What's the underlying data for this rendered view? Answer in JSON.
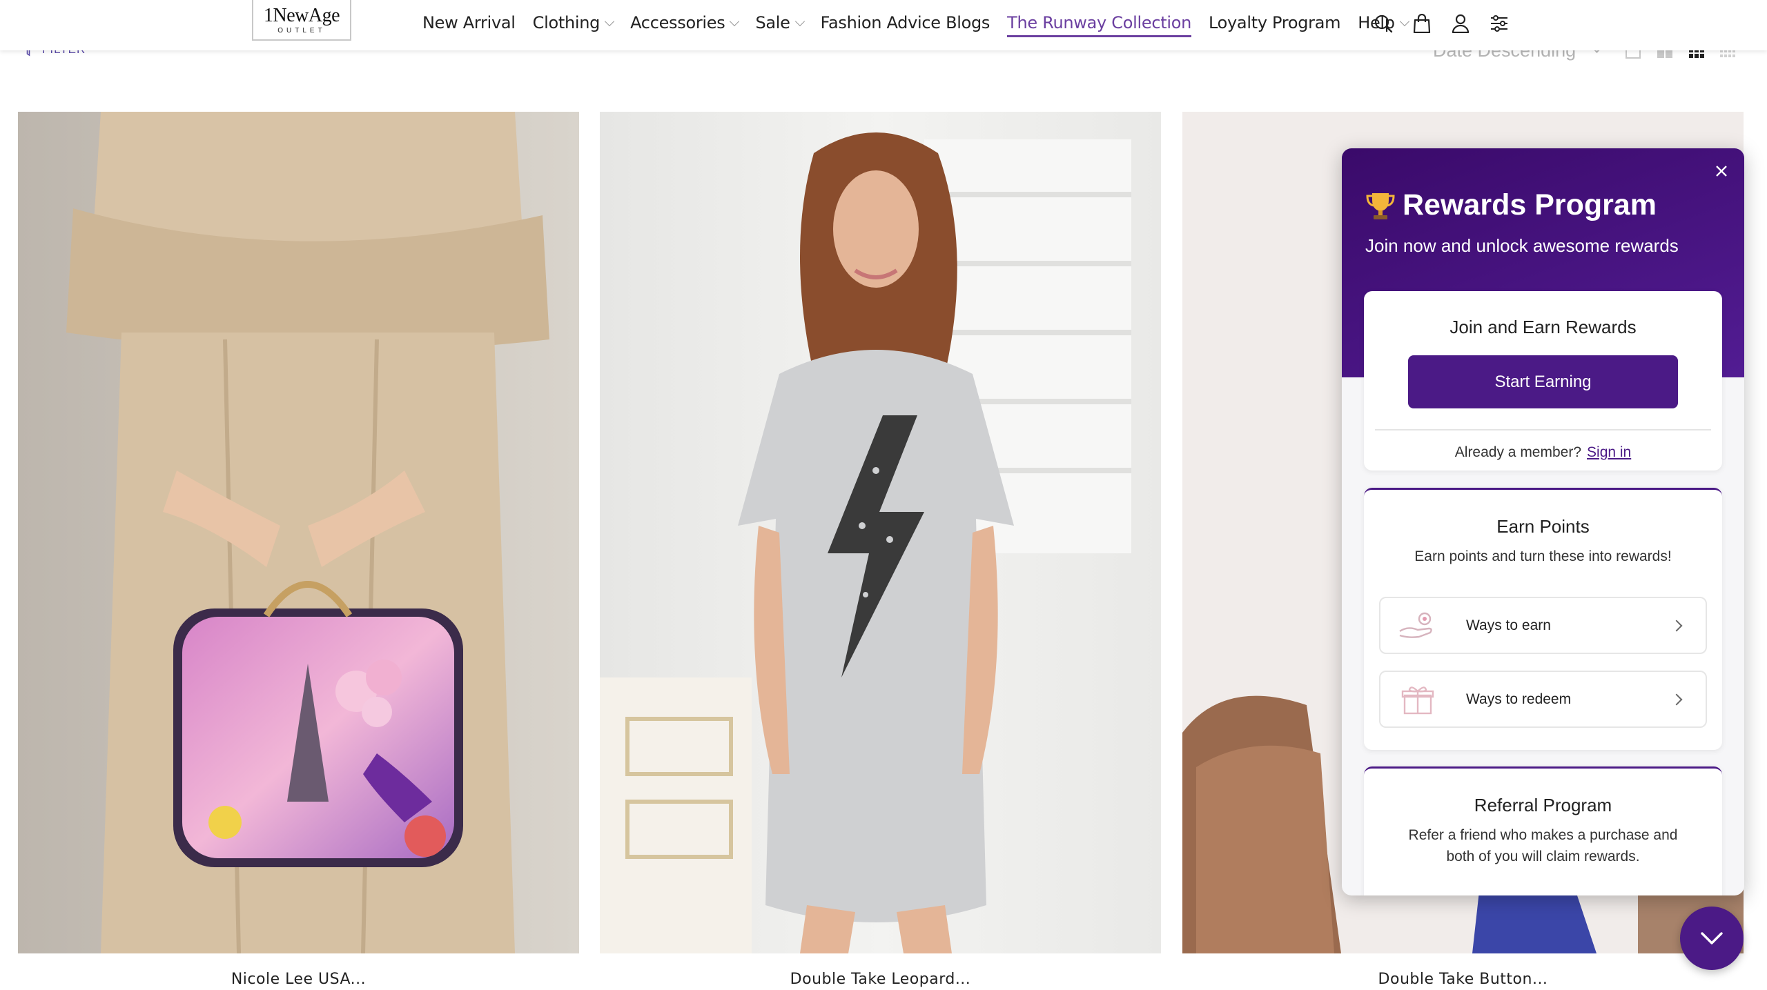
{
  "logo": {
    "main": "1NewAge",
    "sub": "OUTLET"
  },
  "nav": {
    "items": [
      {
        "label": "New Arrival",
        "dropdown": false
      },
      {
        "label": "Clothing",
        "dropdown": true
      },
      {
        "label": "Accessories",
        "dropdown": true
      },
      {
        "label": "Sale",
        "dropdown": true
      },
      {
        "label": "Fashion Advice Blogs",
        "dropdown": false
      },
      {
        "label": "The Runway Collection",
        "dropdown": false,
        "active": true
      },
      {
        "label": "Loyalty Program",
        "dropdown": false
      },
      {
        "label": "Help",
        "dropdown": true
      }
    ],
    "icons": [
      "search-icon",
      "bag-icon",
      "account-icon",
      "settings-sliders-icon"
    ]
  },
  "toolbar": {
    "filter_label": "FILTER",
    "sort_label": "Date Descending",
    "view_options": [
      "view-1-column-icon",
      "view-2-column-icon",
      "view-3-column-icon",
      "view-4-column-icon"
    ],
    "active_view": "view-3-column-icon"
  },
  "products": [
    {
      "name": "Nicole Lee USA..."
    },
    {
      "name": "Double Take Leopard..."
    },
    {
      "name": "Double Take Button..."
    }
  ],
  "rewards": {
    "title": "Rewards Program",
    "subtitle": "Join now and unlock awesome rewards",
    "join": {
      "heading": "Join and Earn Rewards",
      "button": "Start Earning",
      "member_text": "Already a member?",
      "signin": "Sign in"
    },
    "earn": {
      "heading": "Earn Points",
      "text": "Earn points and turn these into rewards!",
      "ways_to_earn": "Ways to earn",
      "ways_to_redeem": "Ways to redeem"
    },
    "referral": {
      "heading": "Referral Program",
      "text": "Refer a friend who makes a purchase and both of you will claim rewards."
    }
  },
  "colors": {
    "brand_purple": "#4b1a86",
    "active_nav": "#6b3fa0",
    "header_gradient_top": "#3a0a6a"
  }
}
